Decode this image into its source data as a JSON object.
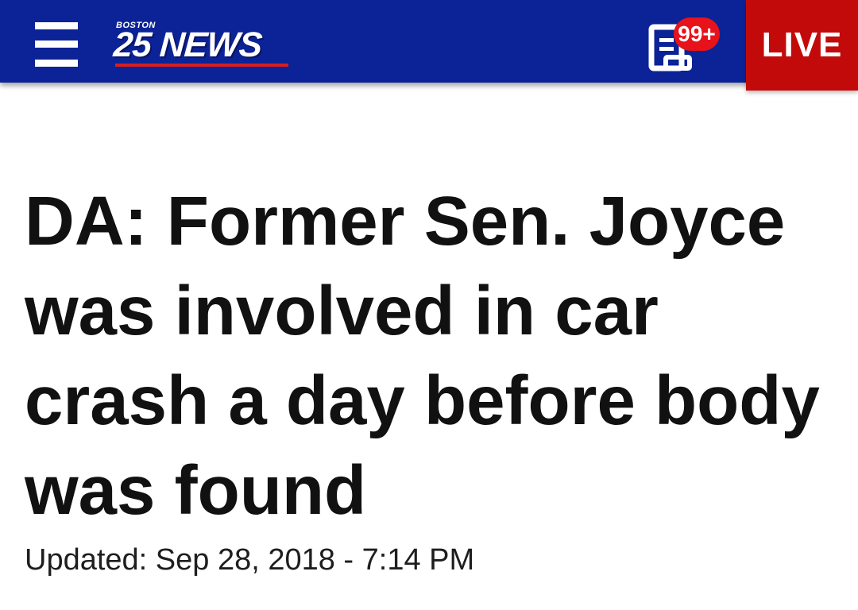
{
  "header": {
    "logo_small": "BOSTON",
    "logo_main": "25 NEWS",
    "notification_badge": "99+",
    "live_label": "LIVE"
  },
  "article": {
    "headline": "DA: Former Sen. Joyce was involved in car crash a day before body was found",
    "updated": "Updated: Sep 28, 2018 - 7:14 PM"
  },
  "icons": {
    "menu": "hamburger-menu-icon",
    "news_feed": "newspaper-icon"
  },
  "colors": {
    "header_bg": "#0b2396",
    "live_bg": "#c30a0a",
    "badge_bg": "#e8131a",
    "logo_underline": "#d81e1e"
  }
}
